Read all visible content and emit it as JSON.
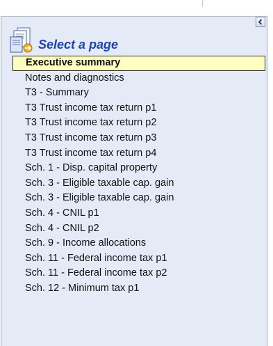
{
  "panel": {
    "title": "Select a page",
    "selected_index": 0,
    "items": [
      {
        "label": "Executive summary"
      },
      {
        "label": "Notes and diagnostics"
      },
      {
        "label": "T3 - Summary"
      },
      {
        "label": "T3 Trust income tax return p1"
      },
      {
        "label": "T3 Trust income tax return p2"
      },
      {
        "label": "T3 Trust income tax return p3"
      },
      {
        "label": "T3 Trust income tax return p4"
      },
      {
        "label": "Sch. 1 - Disp. capital property"
      },
      {
        "label": "Sch. 3 - Eligible taxable cap. gain"
      },
      {
        "label": "Sch. 3 - Eligible taxable cap. gain"
      },
      {
        "label": "Sch. 4 - CNIL p1"
      },
      {
        "label": "Sch. 4 - CNIL p2"
      },
      {
        "label": "Sch. 9 - Income allocations"
      },
      {
        "label": "Sch. 11 - Federal income tax p1"
      },
      {
        "label": "Sch. 11 - Federal income tax p2"
      },
      {
        "label": "Sch. 12 - Minimum tax p1"
      }
    ]
  },
  "icons": {
    "header": "document-pages-icon",
    "collapse": "chevron-left-icon"
  },
  "colors": {
    "title": "#1d43b5",
    "panel_bg": "#e5ebf6",
    "selected_bg": "#ffffc0"
  }
}
